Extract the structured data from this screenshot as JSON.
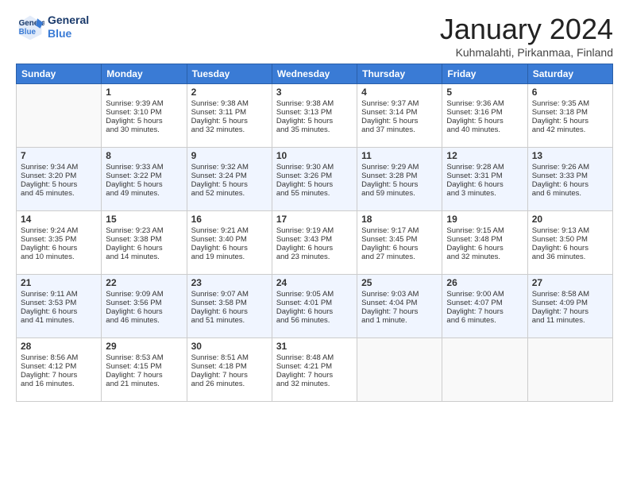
{
  "header": {
    "logo_general": "General",
    "logo_blue": "Blue",
    "month_title": "January 2024",
    "subtitle": "Kuhmalahti, Pirkanmaa, Finland"
  },
  "days_of_week": [
    "Sunday",
    "Monday",
    "Tuesday",
    "Wednesday",
    "Thursday",
    "Friday",
    "Saturday"
  ],
  "weeks": [
    [
      {
        "num": "",
        "info": ""
      },
      {
        "num": "1",
        "info": "Sunrise: 9:39 AM\nSunset: 3:10 PM\nDaylight: 5 hours\nand 30 minutes."
      },
      {
        "num": "2",
        "info": "Sunrise: 9:38 AM\nSunset: 3:11 PM\nDaylight: 5 hours\nand 32 minutes."
      },
      {
        "num": "3",
        "info": "Sunrise: 9:38 AM\nSunset: 3:13 PM\nDaylight: 5 hours\nand 35 minutes."
      },
      {
        "num": "4",
        "info": "Sunrise: 9:37 AM\nSunset: 3:14 PM\nDaylight: 5 hours\nand 37 minutes."
      },
      {
        "num": "5",
        "info": "Sunrise: 9:36 AM\nSunset: 3:16 PM\nDaylight: 5 hours\nand 40 minutes."
      },
      {
        "num": "6",
        "info": "Sunrise: 9:35 AM\nSunset: 3:18 PM\nDaylight: 5 hours\nand 42 minutes."
      }
    ],
    [
      {
        "num": "7",
        "info": "Sunrise: 9:34 AM\nSunset: 3:20 PM\nDaylight: 5 hours\nand 45 minutes."
      },
      {
        "num": "8",
        "info": "Sunrise: 9:33 AM\nSunset: 3:22 PM\nDaylight: 5 hours\nand 49 minutes."
      },
      {
        "num": "9",
        "info": "Sunrise: 9:32 AM\nSunset: 3:24 PM\nDaylight: 5 hours\nand 52 minutes."
      },
      {
        "num": "10",
        "info": "Sunrise: 9:30 AM\nSunset: 3:26 PM\nDaylight: 5 hours\nand 55 minutes."
      },
      {
        "num": "11",
        "info": "Sunrise: 9:29 AM\nSunset: 3:28 PM\nDaylight: 5 hours\nand 59 minutes."
      },
      {
        "num": "12",
        "info": "Sunrise: 9:28 AM\nSunset: 3:31 PM\nDaylight: 6 hours\nand 3 minutes."
      },
      {
        "num": "13",
        "info": "Sunrise: 9:26 AM\nSunset: 3:33 PM\nDaylight: 6 hours\nand 6 minutes."
      }
    ],
    [
      {
        "num": "14",
        "info": "Sunrise: 9:24 AM\nSunset: 3:35 PM\nDaylight: 6 hours\nand 10 minutes."
      },
      {
        "num": "15",
        "info": "Sunrise: 9:23 AM\nSunset: 3:38 PM\nDaylight: 6 hours\nand 14 minutes."
      },
      {
        "num": "16",
        "info": "Sunrise: 9:21 AM\nSunset: 3:40 PM\nDaylight: 6 hours\nand 19 minutes."
      },
      {
        "num": "17",
        "info": "Sunrise: 9:19 AM\nSunset: 3:43 PM\nDaylight: 6 hours\nand 23 minutes."
      },
      {
        "num": "18",
        "info": "Sunrise: 9:17 AM\nSunset: 3:45 PM\nDaylight: 6 hours\nand 27 minutes."
      },
      {
        "num": "19",
        "info": "Sunrise: 9:15 AM\nSunset: 3:48 PM\nDaylight: 6 hours\nand 32 minutes."
      },
      {
        "num": "20",
        "info": "Sunrise: 9:13 AM\nSunset: 3:50 PM\nDaylight: 6 hours\nand 36 minutes."
      }
    ],
    [
      {
        "num": "21",
        "info": "Sunrise: 9:11 AM\nSunset: 3:53 PM\nDaylight: 6 hours\nand 41 minutes."
      },
      {
        "num": "22",
        "info": "Sunrise: 9:09 AM\nSunset: 3:56 PM\nDaylight: 6 hours\nand 46 minutes."
      },
      {
        "num": "23",
        "info": "Sunrise: 9:07 AM\nSunset: 3:58 PM\nDaylight: 6 hours\nand 51 minutes."
      },
      {
        "num": "24",
        "info": "Sunrise: 9:05 AM\nSunset: 4:01 PM\nDaylight: 6 hours\nand 56 minutes."
      },
      {
        "num": "25",
        "info": "Sunrise: 9:03 AM\nSunset: 4:04 PM\nDaylight: 7 hours\nand 1 minute."
      },
      {
        "num": "26",
        "info": "Sunrise: 9:00 AM\nSunset: 4:07 PM\nDaylight: 7 hours\nand 6 minutes."
      },
      {
        "num": "27",
        "info": "Sunrise: 8:58 AM\nSunset: 4:09 PM\nDaylight: 7 hours\nand 11 minutes."
      }
    ],
    [
      {
        "num": "28",
        "info": "Sunrise: 8:56 AM\nSunset: 4:12 PM\nDaylight: 7 hours\nand 16 minutes."
      },
      {
        "num": "29",
        "info": "Sunrise: 8:53 AM\nSunset: 4:15 PM\nDaylight: 7 hours\nand 21 minutes."
      },
      {
        "num": "30",
        "info": "Sunrise: 8:51 AM\nSunset: 4:18 PM\nDaylight: 7 hours\nand 26 minutes."
      },
      {
        "num": "31",
        "info": "Sunrise: 8:48 AM\nSunset: 4:21 PM\nDaylight: 7 hours\nand 32 minutes."
      },
      {
        "num": "",
        "info": ""
      },
      {
        "num": "",
        "info": ""
      },
      {
        "num": "",
        "info": ""
      }
    ]
  ]
}
